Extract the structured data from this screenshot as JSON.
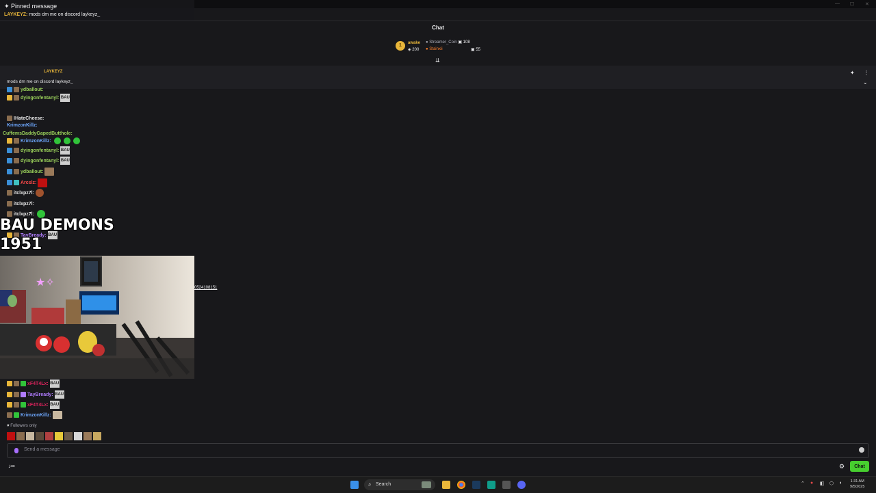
{
  "window": {
    "min": "—",
    "max": "☐",
    "close": "✕"
  },
  "chat": {
    "title": "Chat",
    "leaderboard": {
      "rank": "1",
      "first_name": "awake",
      "first_points": "200",
      "entries": [
        {
          "name": "Streamer_Coin",
          "points": "108"
        },
        {
          "name": "Stainxii",
          "points": "55"
        }
      ]
    },
    "pinned": {
      "header": "Pinned message",
      "author": "LAYKEYZ",
      "author_label": "LAYKEYZ:",
      "message": "mods dm me on discord laykeyz_",
      "message_short": "mods dm me on discord laykeyz_"
    },
    "messages": [
      {
        "user": "ydballout:",
        "color": "#9ad05a",
        "emote": ""
      },
      {
        "user": "dyingonfentanyl:",
        "color": "#9ad05a",
        "emote": "BAU"
      },
      {
        "user": "IHateCheese:",
        "color": "#e8e8e8",
        "emote": ""
      },
      {
        "user": "KrimzonKillz:",
        "color": "#6ea8ff",
        "emote": ""
      },
      {
        "user": "CuffemsDaddyGapedButthole:",
        "color": "#9ad05a",
        "emote": ""
      },
      {
        "user": "KrimzonKillz:",
        "color": "#6ea8ff",
        "emote": ""
      },
      {
        "user": "dyingonfentanyl:",
        "color": "#9ad05a",
        "emote": "BAU"
      },
      {
        "user": "dyingonfentanyl:",
        "color": "#9ad05a",
        "emote": "BAU"
      },
      {
        "user": "ydballout:",
        "color": "#9ad05a",
        "emote": ""
      },
      {
        "user": "Arcslz:",
        "color": "#ff4a4a",
        "emote": ""
      },
      {
        "user": "itclxpz7l:",
        "color": "#e8e8e8",
        "emote": ""
      },
      {
        "user": "itclxpz7l:",
        "color": "#e8e8e8",
        "emote": ""
      },
      {
        "user": "itclxpz7l:",
        "color": "#e8e8e8",
        "emote": ""
      },
      {
        "user": "TayBready:",
        "color": "#b07cff",
        "emote": "BAU"
      },
      {
        "user": "xF4T4Lx:",
        "color": "#e0245e",
        "emote": "BAU"
      },
      {
        "user": "TayBready:",
        "color": "#b07cff",
        "emote": "BAU"
      },
      {
        "user": "xF4T4Lx:",
        "color": "#e0245e",
        "emote": "BAU"
      },
      {
        "user": "KrimzonKillz:",
        "color": "#6ea8ff",
        "emote": ""
      }
    ],
    "followers_only": "Followers only",
    "input_placeholder": "Send a message",
    "send_label": "Chat",
    "settings_icon": "gear-icon"
  },
  "overlay": {
    "title_line1": "BAU DEMONS",
    "title_line2": "1951",
    "cam_link": "0524108151"
  },
  "taskbar": {
    "search_label": "Search",
    "time": "1:31 AM",
    "date": "9/5/2025"
  }
}
